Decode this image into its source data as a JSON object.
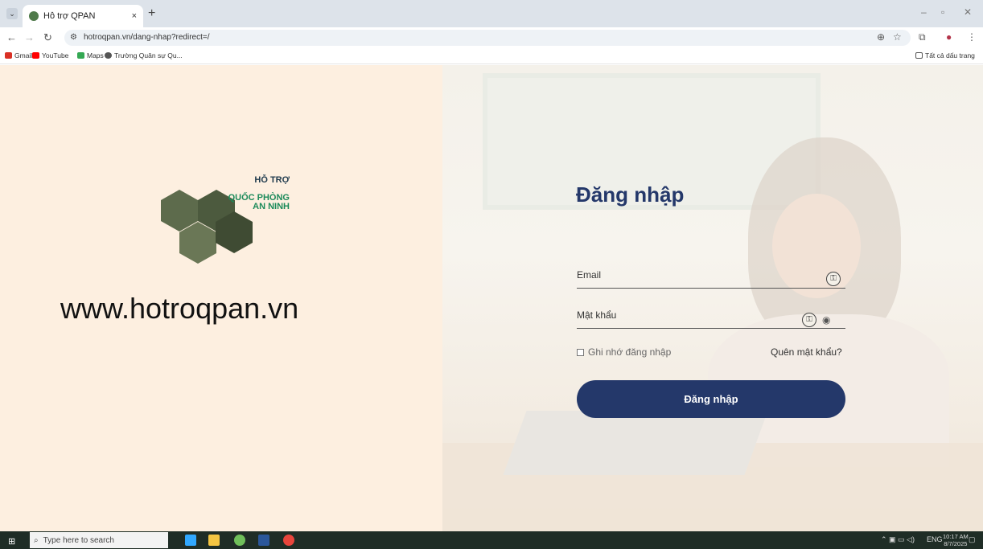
{
  "browser": {
    "tab_title": "Hỗ trợ QPAN",
    "tab_close": "×",
    "new_tab": "+",
    "url": "hotroqpan.vn/dang-nhap?redirect=/",
    "bookmarks": [
      {
        "label": "Gmail",
        "color": "#d93025"
      },
      {
        "label": "YouTube",
        "color": "#ff0000"
      },
      {
        "label": "Maps",
        "color": "#34a853"
      },
      {
        "label": "Trường Quân sự Qu...",
        "color": "#555555"
      }
    ],
    "all_bookmarks": "Tất cả dấu trang"
  },
  "left_panel": {
    "logo_line1": "HỖ TRỢ",
    "logo_line2": "QUỐC PHÒNG\nAN NINH",
    "site_url": "www.hotroqpan.vn"
  },
  "login": {
    "title": "Đăng nhập",
    "email_label": "Email",
    "password_label": "Mật khẩu",
    "remember_label": "Ghi nhớ đăng nhập",
    "forgot_label": "Quên mật khẩu?",
    "submit_label": "Đăng nhập",
    "accent_color": "#24386a"
  },
  "taskbar": {
    "search_placeholder": "Type here to search",
    "language": "ENG",
    "time": "10:17 AM",
    "date": "8/7/2025"
  },
  "icons": [
    "chevron-down-icon",
    "close-icon",
    "back-icon",
    "forward-icon",
    "reload-icon",
    "site-info-icon",
    "zoom-icon",
    "star-icon",
    "extensions-icon",
    "profile-icon",
    "menu-icon",
    "folder-icon",
    "key-icon",
    "eye-icon",
    "windows-icon",
    "search-icon"
  ]
}
